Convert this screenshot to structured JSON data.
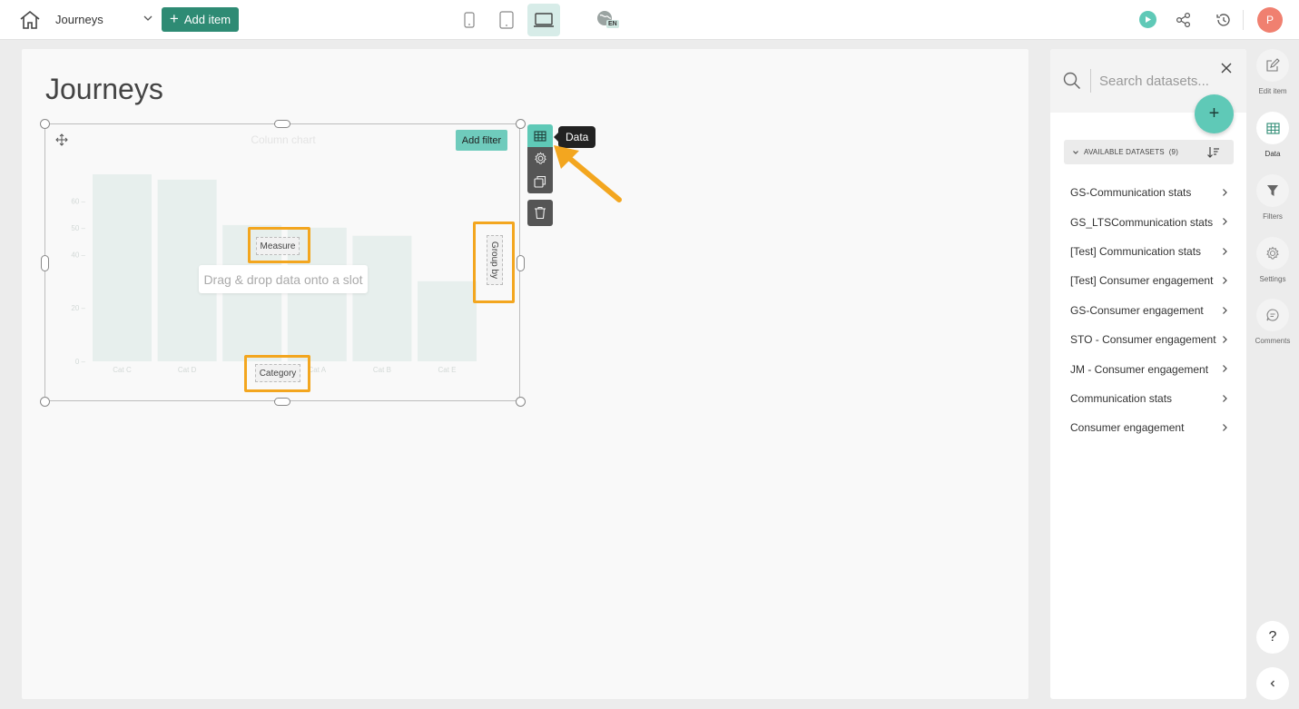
{
  "topbar": {
    "title": "Journeys",
    "add_item_label": "Add item",
    "language_badge": "EN",
    "avatar_initial": "P"
  },
  "page": {
    "title": "Journeys"
  },
  "widget": {
    "chart_title": "Column chart",
    "add_filter_label": "Add filter",
    "drag_message": "Drag & drop data onto a slot",
    "slot_measure": "Measure",
    "slot_category": "Category",
    "slot_group_by": "Group by",
    "tooltip_data": "Data"
  },
  "chart_data": {
    "type": "bar",
    "categories": [
      "Cat C",
      "Cat D",
      "",
      "Cat A",
      "Cat B",
      "Cat E"
    ],
    "values": [
      70,
      68,
      51,
      50,
      47,
      30
    ],
    "y_ticks": [
      "0",
      "20",
      "40",
      "50",
      "60"
    ],
    "ylim": [
      0,
      70
    ],
    "color": "#e7efed",
    "grid": false,
    "title": "Column chart"
  },
  "datasets_panel": {
    "search_placeholder": "Search datasets...",
    "available_label": "AVAILABLE DATASETS",
    "available_count": "(9)",
    "items": [
      "GS-Communication stats",
      "GS_LTSCommunication stats",
      "[Test] Communication stats",
      "[Test] Consumer engagement",
      "GS-Consumer engagement",
      "STO - Consumer engagement",
      "JM - Consumer engagement",
      "Communication stats",
      "Consumer engagement"
    ]
  },
  "rail": {
    "edit_item": "Edit item",
    "data": "Data",
    "filters": "Filters",
    "settings": "Settings",
    "comments": "Comments",
    "help": "?"
  },
  "colors": {
    "accent": "#2e8b74",
    "teal": "#5fc9b7",
    "highlight": "#f3a61f"
  }
}
